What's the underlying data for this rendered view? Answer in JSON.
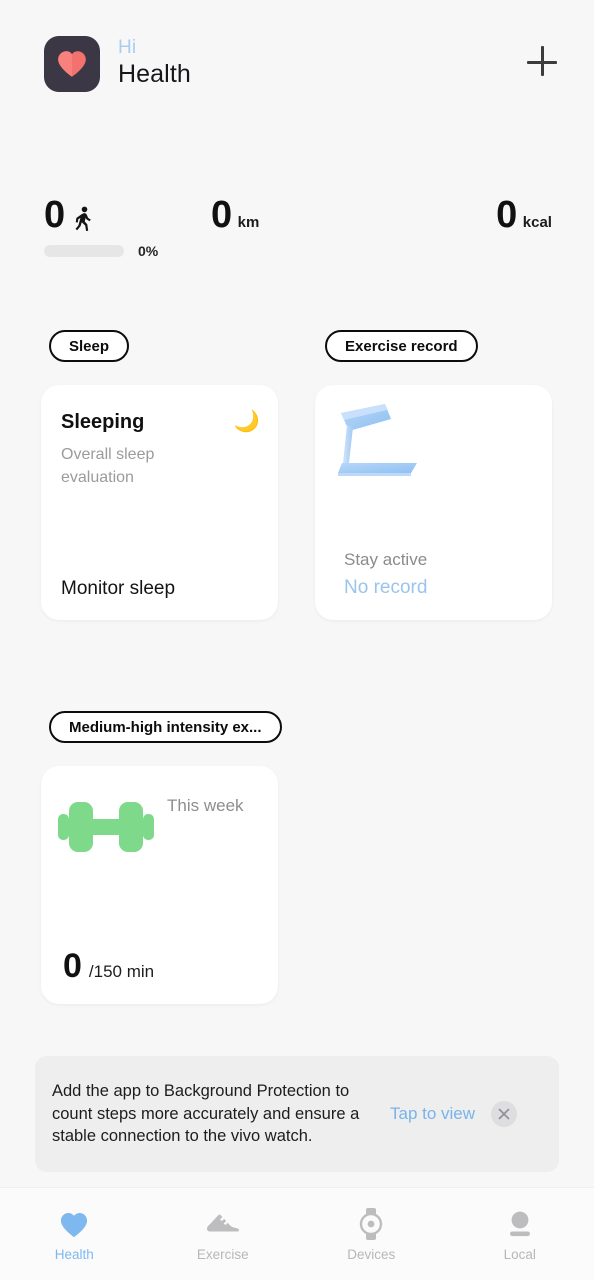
{
  "header": {
    "logo_icon": "heart-icon",
    "greeting": "Hi",
    "title": "Health",
    "add_icon": "plus-icon"
  },
  "stats": {
    "steps": {
      "value": "0",
      "icon": "walking-person-icon"
    },
    "distance": {
      "value": "0",
      "unit": "km"
    },
    "calories": {
      "value": "0",
      "unit": "kcal"
    },
    "progress": {
      "percent_label": "0%",
      "percent": 0
    }
  },
  "sections": {
    "sleep_pill": "Sleep",
    "exercise_record_pill": "Exercise record",
    "medium_high_pill": "Medium-high intensity ex..."
  },
  "sleep_card": {
    "title": "Sleeping",
    "subtitle": "Overall sleep evaluation",
    "action": "Monitor sleep",
    "icon": "crescent-moon-icon",
    "moon_glyph": "🌙"
  },
  "exercise_card": {
    "illustration": "treadmill-icon",
    "caption": "Stay active",
    "status": "No record"
  },
  "intensity_card": {
    "icon": "dumbbell-icon",
    "period": "This week",
    "value": "0",
    "goal": "/150 min"
  },
  "banner": {
    "message": "Add the app to Background Protection to count steps more accurately and ensure a stable connection to the vivo watch.",
    "link": "Tap to view",
    "close_icon": "close-icon"
  },
  "bottom_nav": [
    {
      "label": "Health",
      "icon": "heart-icon",
      "active": true
    },
    {
      "label": "Exercise",
      "icon": "shoe-icon",
      "active": false
    },
    {
      "label": "Devices",
      "icon": "watch-icon",
      "active": false
    },
    {
      "label": "Local",
      "icon": "person-icon",
      "active": false
    }
  ],
  "colors": {
    "accent_blue": "#7fb8ef",
    "heart_red": "#f4726e",
    "logo_bg": "#3b3745",
    "dumbbell_green": "#7ed98a",
    "treadmill_blue": "#a9cef5",
    "moon_yellow": "#f2c33c",
    "page_bg": "#f7f7f7",
    "card_bg": "#ffffff",
    "banner_bg": "#eeeeef"
  }
}
